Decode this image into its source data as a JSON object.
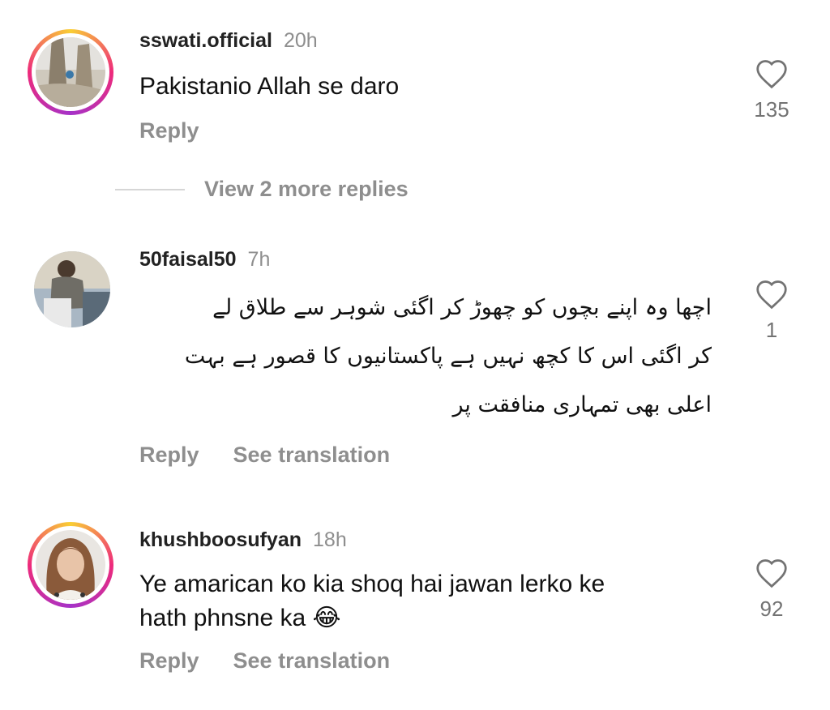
{
  "comments": [
    {
      "username": "sswati.official",
      "time": "20h",
      "text": "Pakistanio Allah se daro",
      "reply_label": "Reply",
      "like_count": "135"
    },
    {
      "username": "50faisal50",
      "time": "7h",
      "text_lines": [
        "اچھا وہ اپنے بچوں کو چھوڑ کر اگئی شوہر سے طلاق لے",
        "کر اگئی اس کا کچھ نہیں ہے پاکستانیوں کا قصور ہے بہت",
        "اعلی بھی تمہاری منافقت پر"
      ],
      "reply_label": "Reply",
      "translation_label": "See translation",
      "like_count": "1"
    },
    {
      "username": "khushboosufyan",
      "time": "18h",
      "text_lines": [
        "Ye amarican ko kia shoq hai jawan lerko ke",
        "hath phnsne ka"
      ],
      "emoji": "😂",
      "reply_label": "Reply",
      "translation_label": "See translation",
      "like_count": "92"
    }
  ],
  "view_more": {
    "label": "View 2 more replies"
  },
  "icons": {
    "like": "heart-outline-icon",
    "emoji": "tears-of-joy-emoji"
  }
}
